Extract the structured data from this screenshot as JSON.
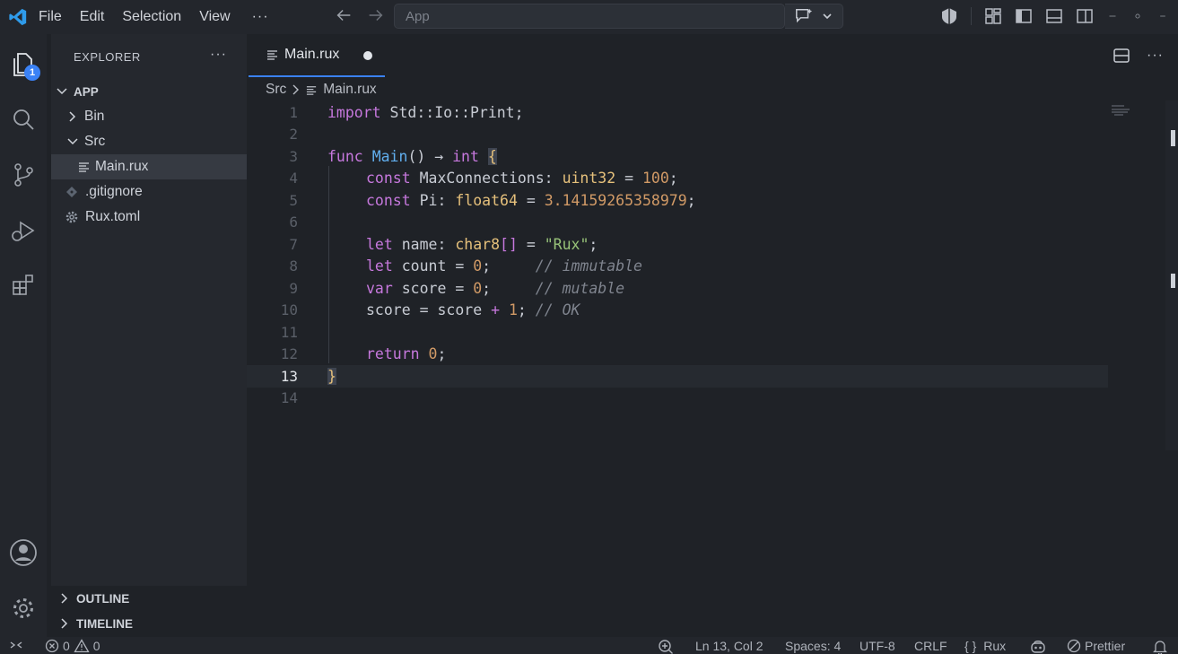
{
  "menu": {
    "file": "File",
    "edit": "Edit",
    "selection": "Selection",
    "view": "View",
    "more": "···"
  },
  "command_center": {
    "placeholder": "App"
  },
  "activity": {
    "explorer_badge": "1"
  },
  "sidebar": {
    "title": "EXPLORER",
    "more": "···",
    "root": "APP",
    "items": [
      {
        "label": "Bin"
      },
      {
        "label": "Src"
      },
      {
        "label": "Main.rux"
      },
      {
        "label": ".gitignore"
      },
      {
        "label": "Rux.toml"
      }
    ],
    "sections": [
      {
        "label": "OUTLINE"
      },
      {
        "label": "TIMELINE"
      }
    ]
  },
  "tabs": [
    {
      "label": "Main.rux"
    }
  ],
  "tab_actions": {
    "more": "···"
  },
  "breadcrumb": {
    "folder": "Src",
    "file": "Main.rux"
  },
  "code": {
    "line_numbers": [
      "1",
      "2",
      "3",
      "4",
      "5",
      "6",
      "7",
      "8",
      "9",
      "10",
      "11",
      "12",
      "13",
      "14"
    ],
    "l1": {
      "kw": "import",
      "rest": " Std::Io::Print;"
    },
    "l3": {
      "kw": "func",
      "fn": "Main",
      "paren": "() → ",
      "ty": "int",
      "brace": "{"
    },
    "l4": {
      "kw": "const",
      "name": " MaxConnections: ",
      "ty": "uint32",
      "eq": " = ",
      "num": "100",
      "semi": ";"
    },
    "l5": {
      "kw": "const",
      "name": " Pi: ",
      "ty": "float64",
      "eq": " = ",
      "num": "3.14159265358979",
      "semi": ";"
    },
    "l7": {
      "kw": "let",
      "name": " name: ",
      "ty": "char8",
      "arr": "[]",
      "eq": " = ",
      "str": "\"Rux\"",
      "semi": ";"
    },
    "l8": {
      "kw": "let",
      "name": " count = ",
      "num": "0",
      "semi": ";     ",
      "com": "// immutable"
    },
    "l9": {
      "kw": "var",
      "name": " score = ",
      "num": "0",
      "semi": ";     ",
      "com": "// mutable"
    },
    "l10": {
      "pre": "score = score ",
      "op": "+",
      "sp": " ",
      "num": "1",
      "semi": "; ",
      "com": "// OK"
    },
    "l12": {
      "kw": "return",
      "sp": " ",
      "num": "0",
      "semi": ";"
    },
    "l13": {
      "brace": "}"
    }
  },
  "status": {
    "errors": "0",
    "warnings": "0",
    "position": "Ln 13, Col 2",
    "spaces": "Spaces: 4",
    "encoding": "UTF-8",
    "eol": "CRLF",
    "language": "Rux",
    "formatter": "Prettier"
  },
  "colors": {
    "accent": "#3b82f6",
    "keyword": "#c678dd",
    "function": "#61afef",
    "type": "#e5c07b",
    "number": "#d19a66",
    "string": "#98c379",
    "comment": "#7f848e"
  }
}
